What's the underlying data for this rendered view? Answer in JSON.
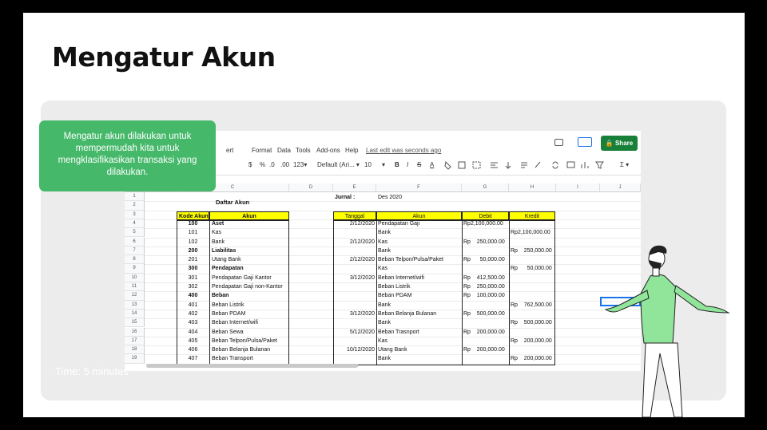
{
  "slide": {
    "title": "Mengatur Akun",
    "callout": "Mengatur akun dilakukan untuk mempermudah kita untuk mengklasifikasikan transaksi yang dilakukan.",
    "timer": "Time: 5 minutes"
  },
  "sheet": {
    "menu": [
      "ert",
      "Format",
      "Data",
      "Tools",
      "Add-ons",
      "Help"
    ],
    "last_edit": "Last edit was seconds ago",
    "share_label": "Share",
    "toolbar": [
      "$",
      "%",
      ".0",
      ".00",
      "123▾",
      "Default (Ari... ▾",
      "10",
      "▾",
      "B",
      "I",
      "S",
      "A",
      "Σ ▾"
    ],
    "col_headers": [
      "C",
      "D",
      "E",
      "F",
      "G",
      "H",
      "I",
      "J"
    ],
    "row_numbers": [
      "1",
      "2",
      "3",
      "4",
      "5",
      "6",
      "7",
      "8",
      "9",
      "10",
      "11",
      "12",
      "13",
      "14",
      "15",
      "16",
      "17",
      "18",
      "19"
    ],
    "daftar_title": "Daftar Akun",
    "jurnal_label": "Jurnal :",
    "jurnal_period": "Des 2020",
    "akun_headers": [
      "Kode Akun",
      "Akun"
    ],
    "akun_rows": [
      {
        "kode": "100",
        "akun": "Aset",
        "bold": true
      },
      {
        "kode": "101",
        "akun": "Kas"
      },
      {
        "kode": "102",
        "akun": "Bank"
      },
      {
        "kode": "200",
        "akun": "Liabilitas",
        "bold": true
      },
      {
        "kode": "201",
        "akun": "Utang Bank"
      },
      {
        "kode": "300",
        "akun": "Pendapatan",
        "bold": true
      },
      {
        "kode": "301",
        "akun": "Pendapatan Gaji Kantor"
      },
      {
        "kode": "302",
        "akun": "Pendapatan Gaji non-Kantor"
      },
      {
        "kode": "400",
        "akun": "Beban",
        "bold": true
      },
      {
        "kode": "401",
        "akun": "Beban Listrik"
      },
      {
        "kode": "402",
        "akun": "Beban PDAM"
      },
      {
        "kode": "403",
        "akun": "Beban Internet/wifi"
      },
      {
        "kode": "404",
        "akun": "Beban Sewa"
      },
      {
        "kode": "405",
        "akun": "Beban Telpon/Pulsa/Paket"
      },
      {
        "kode": "406",
        "akun": "Beban Belanja Bulanan"
      },
      {
        "kode": "407",
        "akun": "Beban Transport"
      }
    ],
    "jurnal_headers": [
      "Tanggal",
      "Akun",
      "Debit",
      "Kredit"
    ],
    "jurnal_rows": [
      {
        "tanggal": "2/12/2020",
        "akun": "Pendapatan Gaji",
        "debit": "Rp2,100,000.00",
        "kredit": ""
      },
      {
        "tanggal": "",
        "akun": "Bank",
        "debit": "",
        "kredit": "Rp2,100,000.00"
      },
      {
        "tanggal": "2/12/2020",
        "akun": "Kas",
        "debit": "Rp    250,000.00",
        "kredit": ""
      },
      {
        "tanggal": "",
        "akun": "Bank",
        "debit": "",
        "kredit": "Rp    250,000.00"
      },
      {
        "tanggal": "2/12/2020",
        "akun": "Beban Telpon/Pulsa/Paket",
        "debit": "Rp      50,000.00",
        "kredit": ""
      },
      {
        "tanggal": "",
        "akun": "Kas",
        "debit": "",
        "kredit": "Rp      50,000.00"
      },
      {
        "tanggal": "3/12/2020",
        "akun": "Beban Internet/wifi",
        "debit": "Rp    412,500.00",
        "kredit": ""
      },
      {
        "tanggal": "",
        "akun": "Beban Listrik",
        "debit": "Rp    250,000.00",
        "kredit": ""
      },
      {
        "tanggal": "",
        "akun": "Beban PDAM",
        "debit": "Rp    100,000.00",
        "kredit": ""
      },
      {
        "tanggal": "",
        "akun": "Bank",
        "debit": "",
        "kredit": "Rp    762,500.00"
      },
      {
        "tanggal": "3/12/2020",
        "akun": "Beban Belanja Bulanan",
        "debit": "Rp    500,000.00",
        "kredit": ""
      },
      {
        "tanggal": "",
        "akun": "Bank",
        "debit": "",
        "kredit": "Rp    500,000.00"
      },
      {
        "tanggal": "5/12/2020",
        "akun": "Beban Trasnport",
        "debit": "Rp    200,000.00",
        "kredit": ""
      },
      {
        "tanggal": "",
        "akun": "Kas",
        "debit": "",
        "kredit": "Rp    200,000.00"
      },
      {
        "tanggal": "10/12/2020",
        "akun": "Utang Bank",
        "debit": "Rp    200,000.00",
        "kredit": ""
      },
      {
        "tanggal": "",
        "akun": "Bank",
        "debit": "",
        "kredit": "Rp    200,000.00"
      }
    ]
  },
  "colors": {
    "accent_green": "#45b86a",
    "share_green": "#188038",
    "header_yellow": "#ffff00",
    "figure_shirt": "#90e59a"
  }
}
